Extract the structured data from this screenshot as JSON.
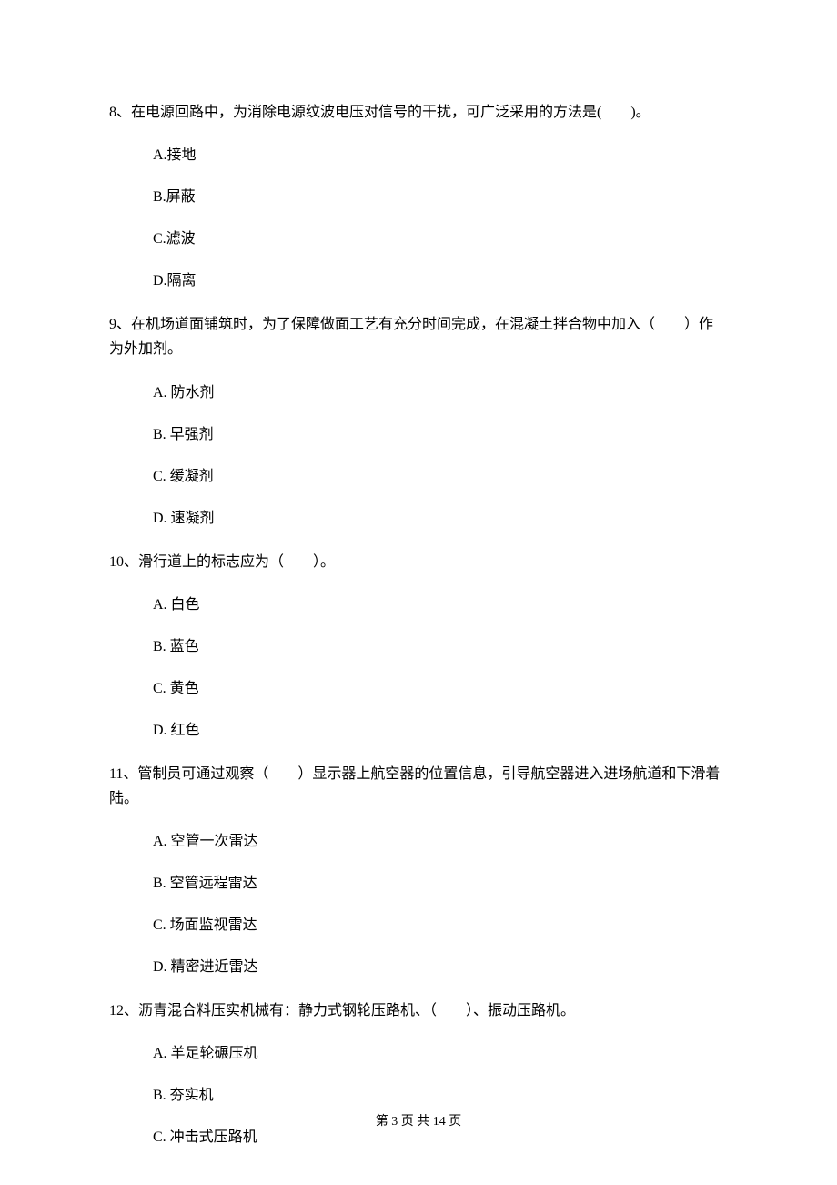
{
  "questions": [
    {
      "number": "8、",
      "text": "在电源回路中，为消除电源纹波电压对信号的干扰，可广泛采用的方法是(　　)。",
      "options": [
        "A.接地",
        "B.屏蔽",
        "C.滤波",
        "D.隔离"
      ]
    },
    {
      "number": "9、",
      "text": "在机场道面铺筑时，为了保障做面工艺有充分时间完成，在混凝土拌合物中加入（　　）作为外加剂。",
      "options": [
        "A. 防水剂",
        "B. 早强剂",
        "C. 缓凝剂",
        "D. 速凝剂"
      ]
    },
    {
      "number": "10、",
      "text": "滑行道上的标志应为（　　）。",
      "options": [
        "A. 白色",
        "B. 蓝色",
        "C. 黄色",
        "D. 红色"
      ]
    },
    {
      "number": "11、",
      "text": "管制员可通过观察（　　）显示器上航空器的位置信息，引导航空器进入进场航道和下滑着陆。",
      "options": [
        "A. 空管一次雷达",
        "B. 空管远程雷达",
        "C. 场面监视雷达",
        "D. 精密进近雷达"
      ]
    },
    {
      "number": "12、",
      "text": "沥青混合料压实机械有：静力式钢轮压路机、（　　）、振动压路机。",
      "options": [
        "A. 羊足轮碾压机",
        "B. 夯实机",
        "C. 冲击式压路机"
      ]
    }
  ],
  "footer": "第 3 页 共 14 页"
}
